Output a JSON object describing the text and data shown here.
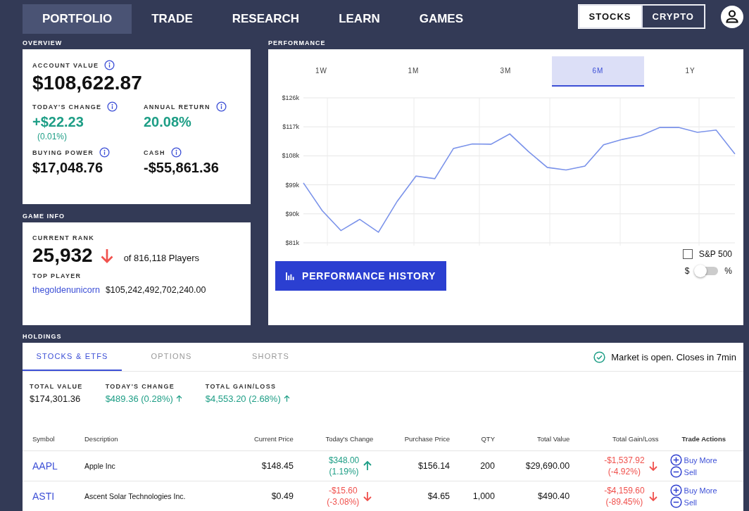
{
  "nav": {
    "tabs": [
      {
        "label": "PORTFOLIO",
        "selected": true
      },
      {
        "label": "TRADE",
        "selected": false
      },
      {
        "label": "RESEARCH",
        "selected": false
      },
      {
        "label": "LEARN",
        "selected": false
      },
      {
        "label": "GAMES",
        "selected": false
      }
    ],
    "market_toggle": [
      {
        "label": "STOCKS",
        "selected": true
      },
      {
        "label": "CRYPTO",
        "selected": false
      }
    ]
  },
  "overview": {
    "title": "OVERVIEW",
    "account_value": {
      "label": "ACCOUNT VALUE",
      "value": "$108,622.87"
    },
    "stats": [
      {
        "label": "TODAY'S CHANGE",
        "value": "+$22.23",
        "sub": "(0.01%)",
        "kind": "gain"
      },
      {
        "label": "ANNUAL RETURN",
        "value": "20.08%",
        "kind": "gain"
      },
      {
        "label": "BUYING POWER",
        "value": "$17,048.76",
        "kind": "plain"
      },
      {
        "label": "CASH",
        "value": "-$55,861.36",
        "kind": "plain"
      }
    ]
  },
  "game_info": {
    "title": "GAME INFO",
    "rank_label": "CURRENT RANK",
    "rank": "25,932",
    "rank_falling": true,
    "players": "of 816,118 Players",
    "top_label": "TOP PLAYER",
    "top_player": "thegoldenunicorn",
    "top_value": "$105,242,492,702,240.00"
  },
  "performance": {
    "title": "PERFORMANCE",
    "periods": [
      {
        "label": "1W",
        "selected": false
      },
      {
        "label": "1M",
        "selected": false
      },
      {
        "label": "3M",
        "selected": false
      },
      {
        "label": "6M",
        "selected": true
      },
      {
        "label": "1Y",
        "selected": false
      }
    ],
    "chart_data": {
      "type": "line",
      "grid": true,
      "ylim": [
        81,
        126
      ],
      "yticks": [
        {
          "value": 81,
          "label": "$81k"
        },
        {
          "value": 90,
          "label": "$90k"
        },
        {
          "value": 99,
          "label": "$99k"
        },
        {
          "value": 108,
          "label": "$108k"
        },
        {
          "value": 117,
          "label": "$117k"
        },
        {
          "value": 126,
          "label": "$126k"
        }
      ],
      "series": [
        {
          "color": "#7b93ea",
          "values": [
            99.6,
            91.0,
            84.8,
            88.3,
            84.3,
            93.9,
            101.7,
            100.9,
            110.3,
            111.7,
            111.6,
            114.8,
            109.3,
            104.4,
            103.6,
            104.8,
            111.4,
            113.1,
            114.3,
            116.8,
            116.8,
            115.3,
            116.0,
            108.6
          ]
        }
      ]
    },
    "history_button": "PERFORMANCE HISTORY",
    "benchmark": {
      "label": "S&P 500",
      "checked": false
    },
    "unit_toggle": {
      "left": "$",
      "right": "%",
      "on": false
    }
  },
  "holdings": {
    "title": "HOLDINGS",
    "tabs": [
      {
        "label": "STOCKS & ETFS",
        "selected": true
      },
      {
        "label": "OPTIONS",
        "selected": false
      },
      {
        "label": "SHORTS",
        "selected": false
      }
    ],
    "market_status": "Market is open. Closes in 7min",
    "totals": [
      {
        "label": "TOTAL VALUE",
        "value": "$174,301.36",
        "kind": "plain"
      },
      {
        "label": "TODAY'S CHANGE",
        "value": "$489.36 (0.28%)",
        "kind": "gain"
      },
      {
        "label": "TOTAL GAIN/LOSS",
        "value": "$4,553.20 (2.68%)",
        "kind": "gain"
      }
    ],
    "columns": [
      "Symbol",
      "Description",
      "Current Price",
      "Today's Change",
      "Purchase Price",
      "QTY",
      "Total Value",
      "Total Gain/Loss",
      "Trade Actions"
    ],
    "rows": [
      {
        "symbol": "AAPL",
        "description": "Apple Inc",
        "price": "$148.45",
        "change": "$348.00",
        "change_pct": "(1.19%)",
        "change_rising": true,
        "purchase": "$156.14",
        "qty": "200",
        "value": "$29,690.00",
        "gain": "-$1,537.92",
        "gain_pct": "(-4.92%)",
        "gain_rising": false,
        "buy": "Buy More",
        "sell": "Sell"
      },
      {
        "symbol": "ASTI",
        "description": "Ascent Solar Technologies Inc.",
        "price": "$0.49",
        "change": "-$15.60",
        "change_pct": "(-3.08%)",
        "change_rising": false,
        "purchase": "$4.65",
        "qty": "1,000",
        "value": "$490.40",
        "gain": "-$4,159.60",
        "gain_pct": "(-89.45%)",
        "gain_rising": false,
        "buy": "Buy More",
        "sell": "Sell"
      }
    ]
  }
}
